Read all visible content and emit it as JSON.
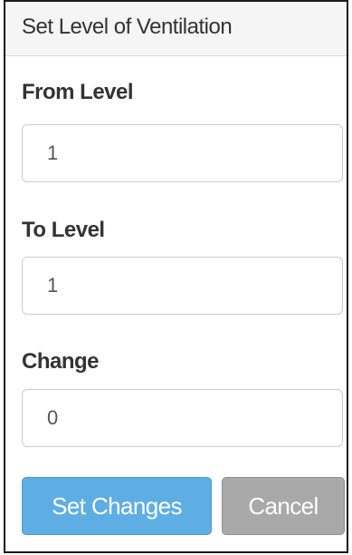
{
  "panel": {
    "title": "Set Level of Ventilation"
  },
  "fields": {
    "from_level": {
      "label": "From Level",
      "value": "1"
    },
    "to_level": {
      "label": "To Level",
      "value": "1"
    },
    "change": {
      "label": "Change",
      "value": "0"
    }
  },
  "actions": {
    "submit_label": "Set Changes",
    "cancel_label": "Cancel"
  },
  "colors": {
    "primary_button": "#5eaee3",
    "cancel_button": "#a9a9a9",
    "header_background": "#f5f5f5"
  }
}
